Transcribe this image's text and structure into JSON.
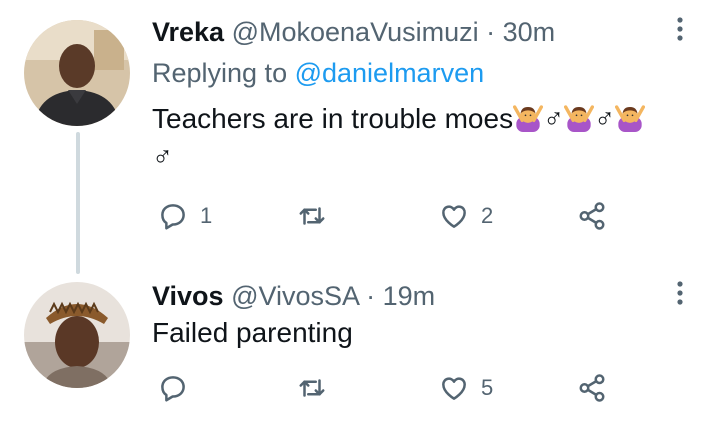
{
  "tweets": [
    {
      "name": "Vreka",
      "handle": "@MokoenaVusimuzi",
      "separator": "·",
      "time": "30m",
      "replying_prefix": "Replying to ",
      "replying_to": "@danielmarven",
      "text": "Teachers are in trouble moes",
      "text_trailing_symbol": "♂",
      "emojis": [
        "person-gesturing-no-emoji",
        "person-gesturing-no-emoji",
        "person-gesturing-no-emoji"
      ],
      "gender_sign": "♂",
      "actions": {
        "replies": "1",
        "retweets": "",
        "likes": "2"
      }
    },
    {
      "name": "Vivos",
      "handle": "@VivosSA",
      "separator": "·",
      "time": "19m",
      "text": "Failed parenting",
      "actions": {
        "replies": "",
        "retweets": "",
        "likes": "5"
      }
    }
  ],
  "icons": {
    "reply": "reply-icon",
    "retweet": "retweet-icon",
    "like": "heart-icon",
    "share": "share-icon",
    "more": "more-options-icon"
  },
  "colors": {
    "text": "#0f1419",
    "secondary": "#536471",
    "link": "#1d9bf0",
    "thread_line": "#cfd9de",
    "emoji_purple": "#9b59b6"
  }
}
